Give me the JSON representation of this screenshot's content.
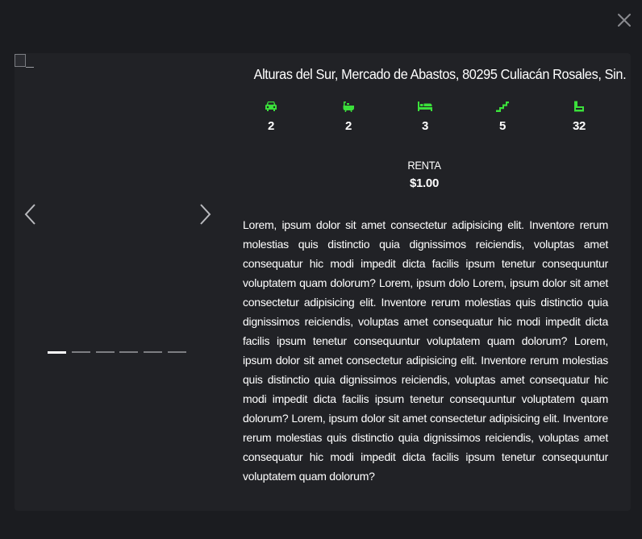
{
  "modal": {
    "close_label": "close"
  },
  "carousel": {
    "image_alt": "_",
    "slide_count": 6,
    "active_slide": 1,
    "prev_icon": "chevron-left-icon",
    "next_icon": "chevron-right-icon"
  },
  "property": {
    "address": "Alturas del Sur, Mercado de Abastos, 80295 Culiacán Rosales, Sin.",
    "features": [
      {
        "icon": "car-icon",
        "value": "2"
      },
      {
        "icon": "bathtub-icon",
        "value": "2"
      },
      {
        "icon": "bed-icon",
        "value": "3"
      },
      {
        "icon": "stairs-icon",
        "value": "5"
      },
      {
        "icon": "area-icon",
        "value": "32"
      }
    ],
    "price_label": "RENTA",
    "price_value": "$1.00",
    "description": "Lorem, ipsum dolor sit amet consectetur adipisicing elit. Inventore rerum molestias quis distinctio quia dignissimos reiciendis, voluptas amet consequatur hic modi impedit dicta facilis ipsum tenetur consequuntur voluptatem quam dolorum? Lorem, ipsum dolo Lorem, ipsum dolor sit amet consectetur adipisicing elit. Inventore rerum molestias quis distinctio quia dignissimos reiciendis, voluptas amet consequatur hic modi impedit dicta facilis ipsum tenetur consequuntur voluptatem quam dolorum? Lorem, ipsum dolor sit amet consectetur adipisicing elit. Inventore rerum molestias quis distinctio quia dignissimos reiciendis, voluptas amet consequatur hic modi impedit dicta facilis ipsum tenetur consequuntur voluptatem quam dolorum? Lorem, ipsum dolor sit amet consectetur adipisicing elit. Inventore rerum molestias quis distinctio quia dignissimos reiciendis, voluptas amet consequatur hic modi impedit dicta facilis ipsum tenetur consequuntur voluptatem quam dolorum?"
  },
  "colors": {
    "accent": "#3be03b",
    "background": "#1b1c20",
    "card": "#212226",
    "text": "#ffffff"
  }
}
